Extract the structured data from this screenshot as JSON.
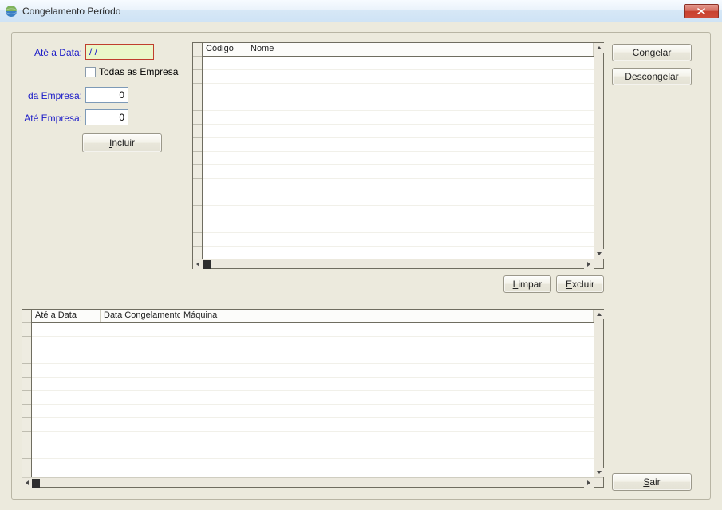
{
  "window": {
    "title": "Congelamento Período"
  },
  "form": {
    "ate_data_label": "Até a Data:",
    "ate_data_value": "/ /",
    "todas_empresas_label": "Todas as Empresa",
    "todas_empresas_checked": false,
    "da_empresa_label": "da Empresa:",
    "da_empresa_value": "0",
    "ate_empresa_label": "Até Empresa:",
    "ate_empresa_value": "0",
    "incluir_label": "Incluir"
  },
  "actions": {
    "congelar": "Congelar",
    "descongelar": "Descongelar",
    "limpar": "Limpar",
    "excluir": "Excluir",
    "sair": "Sair"
  },
  "grid1": {
    "columns": [
      "Código",
      "Nome"
    ],
    "rows": []
  },
  "grid2": {
    "columns": [
      "Até a Data",
      "Data Congelamento",
      "Máquina"
    ],
    "rows": []
  }
}
